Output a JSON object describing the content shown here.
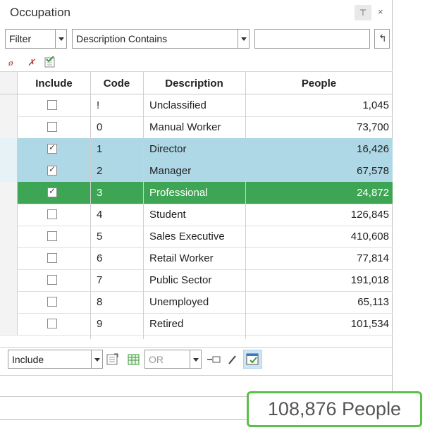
{
  "panel": {
    "title": "Occupation",
    "pin_glyph": "⊤",
    "close_glyph": "×"
  },
  "filter_bar": {
    "mode": "Filter",
    "criterion": "Description Contains",
    "value": "",
    "clear_glyph": "↰"
  },
  "toolbar_icons": [
    "clear-filter-icon",
    "remove-selection-icon",
    "select-all-icon"
  ],
  "grid": {
    "columns": [
      "Include",
      "Code",
      "Description",
      "People"
    ],
    "rows": [
      {
        "include": false,
        "code": "!",
        "description": "Unclassified",
        "people": "1,045",
        "state": "normal"
      },
      {
        "include": false,
        "code": "0",
        "description": "Manual Worker",
        "people": "73,700",
        "state": "normal"
      },
      {
        "include": true,
        "code": "1",
        "description": "Director",
        "people": "16,426",
        "state": "selected"
      },
      {
        "include": true,
        "code": "2",
        "description": "Manager",
        "people": "67,578",
        "state": "selected"
      },
      {
        "include": true,
        "code": "3",
        "description": "Professional",
        "people": "24,872",
        "state": "active"
      },
      {
        "include": false,
        "code": "4",
        "description": "Student",
        "people": "126,845",
        "state": "normal"
      },
      {
        "include": false,
        "code": "5",
        "description": "Sales Executive",
        "people": "410,608",
        "state": "normal"
      },
      {
        "include": false,
        "code": "6",
        "description": "Retail Worker",
        "people": "77,814",
        "state": "normal"
      },
      {
        "include": false,
        "code": "7",
        "description": "Public Sector",
        "people": "191,018",
        "state": "normal"
      },
      {
        "include": false,
        "code": "8",
        "description": "Unemployed",
        "people": "65,113",
        "state": "normal"
      },
      {
        "include": false,
        "code": "9",
        "description": "Retired",
        "people": "101,534",
        "state": "normal"
      }
    ]
  },
  "bottom_bar": {
    "include_mode": "Include",
    "logic": "OR"
  },
  "total": "108,876 People",
  "colors": {
    "selected_row": "#aed8e6",
    "active_row": "#3da554",
    "total_border": "#5cbf49"
  }
}
